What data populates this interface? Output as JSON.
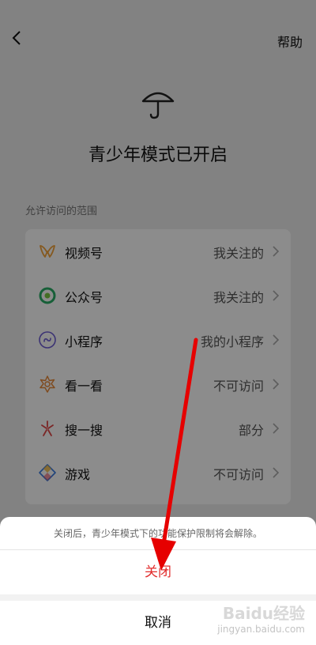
{
  "header": {
    "help_label": "帮助"
  },
  "title": "青少年模式已开启",
  "section_label": "允许访问的范围",
  "items": [
    {
      "label": "视频号",
      "value": "我关注的",
      "icon": "channels-icon"
    },
    {
      "label": "公众号",
      "value": "我关注的",
      "icon": "official-account-icon"
    },
    {
      "label": "小程序",
      "value": "我的小程序",
      "icon": "mini-program-icon"
    },
    {
      "label": "看一看",
      "value": "不可访问",
      "icon": "top-stories-icon"
    },
    {
      "label": "搜一搜",
      "value": "部分",
      "icon": "search-icon"
    },
    {
      "label": "游戏",
      "value": "不可访问",
      "icon": "games-icon"
    }
  ],
  "sheet": {
    "message": "关闭后，青少年模式下的功能保护限制将会解除。",
    "close_label": "关闭",
    "cancel_label": "取消"
  },
  "watermark": {
    "brand": "Baidu经验",
    "url": "jingyan.baidu.com"
  },
  "colors": {
    "accent_red": "#e22d2d",
    "annotation_arrow": "#e60000"
  }
}
